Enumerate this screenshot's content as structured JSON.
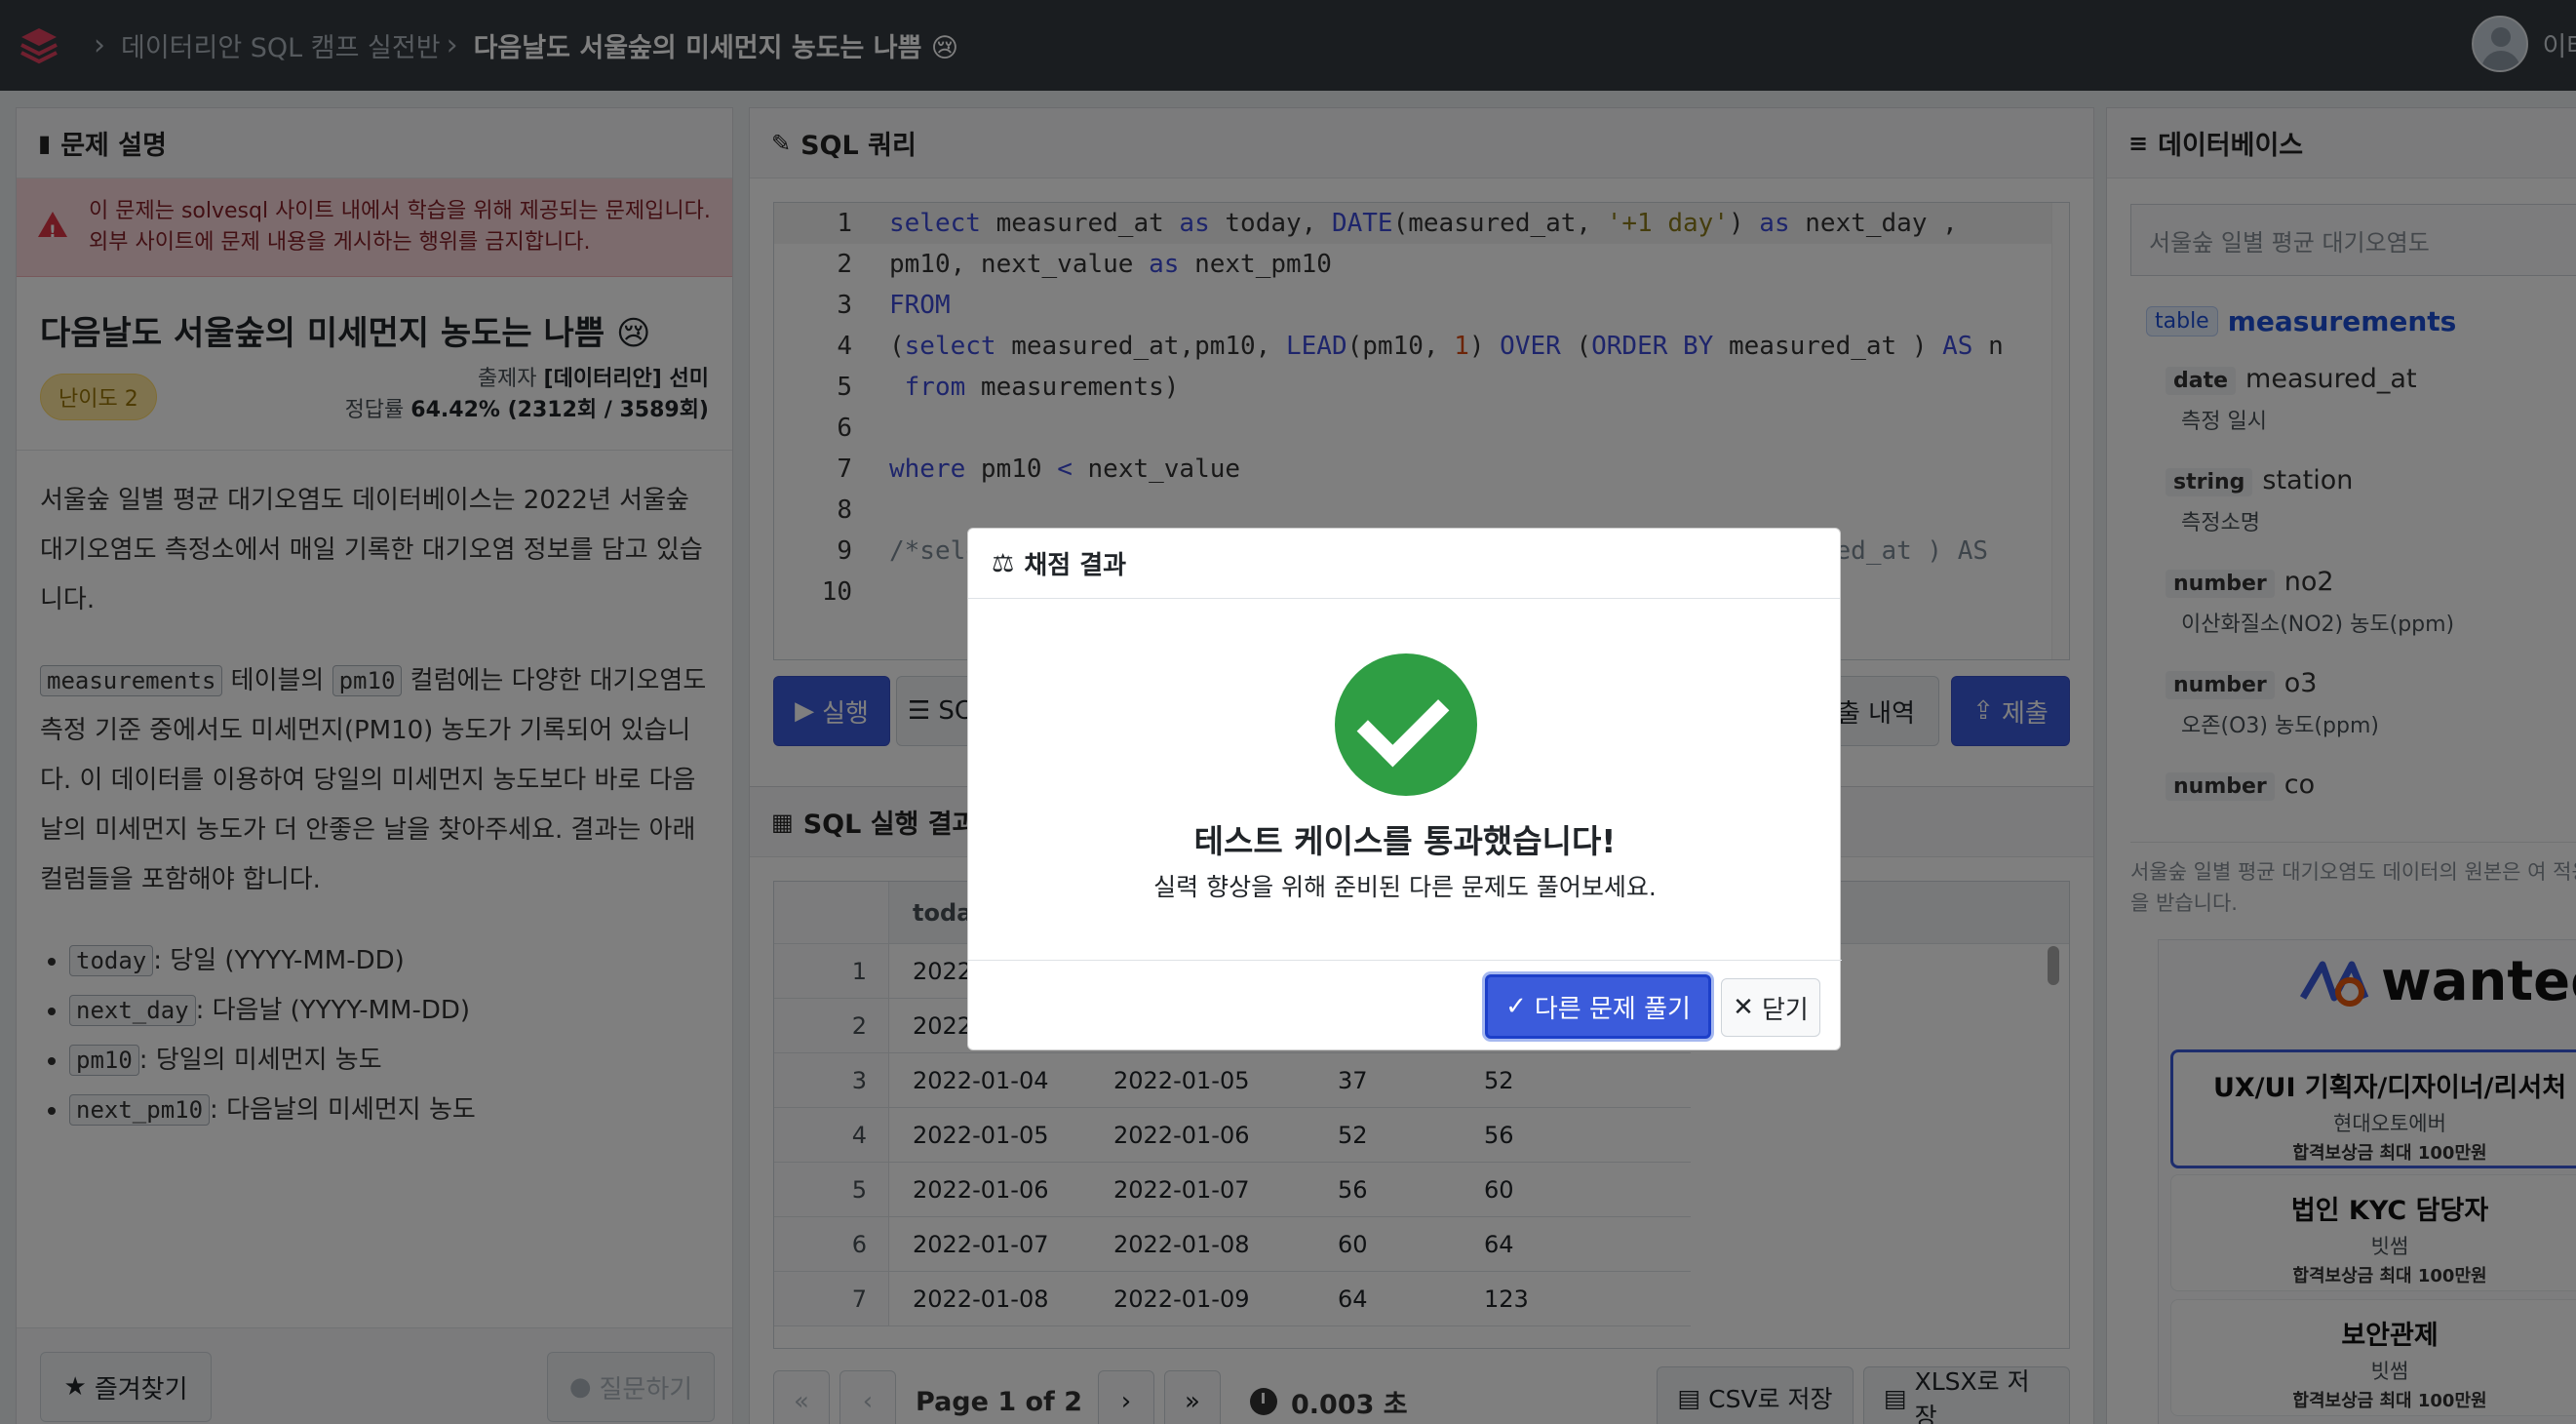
{
  "nav": {
    "breadcrumb_course": "데이터리안 SQL 캠프 실전반",
    "breadcrumb_problem": "다음날도 서울숲의 미세먼지 농도는 나쁨 😢",
    "user_name": "이태균"
  },
  "left": {
    "header": "문제 설명",
    "alert_line1": "이 문제는 solvesql 사이트 내에서 학습을 위해 제공되는 문제입니다.",
    "alert_line2": "외부 사이트에 문제 내용을 게시하는 행위를 금지합니다.",
    "title": "다음날도 서울숲의 미세먼지 농도는 나쁨 😢",
    "difficulty": "난이도 2",
    "author_label": "출제자",
    "author": "[데이터리안] 선미",
    "rate_label": "정답률",
    "rate": "64.42% (2312회 / 3589회)",
    "para1": "서울숲 일별 평균 대기오염도 데이터베이스는 2022년 서울숲 대기오염도 측정소에서 매일 기록한 대기오염 정보를 담고 있습니다.",
    "code_measurements": "measurements",
    "para2_a": " 테이블의 ",
    "code_pm10": "pm10",
    "para2_b": " 컬럼에는 다양한 대기오염도 측정 기준 중에서도 미세먼지(PM10) 농도가 기록되어 있습니다. 이 데이터를 이용하여 당일의 미세먼지 농도보다 바로 다음날의 미세먼지 농도가 더 안좋은 날을 찾아주세요. 결과는 아래 컬럼들을 포함해야 합니다.",
    "columns": [
      {
        "code": "today",
        "desc": ": 당일 (YYYY-MM-DD)"
      },
      {
        "code": "next_day",
        "desc": ": 다음날 (YYYY-MM-DD)"
      },
      {
        "code": "pm10",
        "desc": ": 당일의 미세먼지 농도"
      },
      {
        "code": "next_pm10",
        "desc": ": 다음날의 미세먼지 농도"
      }
    ],
    "fav_label": "즐겨찾기",
    "ask_label": "질문하기"
  },
  "sql": {
    "header": "SQL 쿼리",
    "run_label": "실행",
    "sc_label": "SC",
    "history_label": "출 내역",
    "submit_label": "제출"
  },
  "result": {
    "header": "SQL 실행 결과",
    "col_today": "today",
    "rows": [
      {
        "idx": "1",
        "today": "2022",
        "next": "",
        "pm10": "",
        "npm10": ""
      },
      {
        "idx": "2",
        "today": "2022",
        "next": "",
        "pm10": "",
        "npm10": ""
      },
      {
        "idx": "3",
        "today": "2022-01-04",
        "next": "2022-01-05",
        "pm10": "37",
        "npm10": "52"
      },
      {
        "idx": "4",
        "today": "2022-01-05",
        "next": "2022-01-06",
        "pm10": "52",
        "npm10": "56"
      },
      {
        "idx": "5",
        "today": "2022-01-06",
        "next": "2022-01-07",
        "pm10": "56",
        "npm10": "60"
      },
      {
        "idx": "6",
        "today": "2022-01-07",
        "next": "2022-01-08",
        "pm10": "60",
        "npm10": "64"
      },
      {
        "idx": "7",
        "today": "2022-01-08",
        "next": "2022-01-09",
        "pm10": "64",
        "npm10": "123"
      }
    ],
    "page_text": "Page 1 of 2",
    "time_text": "0.003 초",
    "csv_label": "CSV로 저장",
    "xlsx_label": "XLSX로 저장"
  },
  "db": {
    "header": "데이터베이스",
    "search_value": "서울숲 일별 평균 대기오염도",
    "table_badge": "table",
    "table_name": "measurements",
    "columns": [
      {
        "type": "date",
        "name": "measured_at",
        "desc": "측정 일시"
      },
      {
        "type": "string",
        "name": "station",
        "desc": "측정소명"
      },
      {
        "type": "number",
        "name": "no2",
        "desc": "이산화질소(NO2) 농도(ppm)"
      },
      {
        "type": "number",
        "name": "o3",
        "desc": "오존(O3) 농도(ppm)"
      },
      {
        "type": "number",
        "name": "co",
        "desc": ""
      }
    ],
    "note": "서울숲 일별 평균 대기오염도 데이터의 원본은 여 적용을 받습니다.",
    "ad_brand": "wanted",
    "jobs": [
      {
        "title": "UX/UI 기획자/디자이너/리서처",
        "company": "현대오토에버",
        "reward": "합격보상금 최대 100만원"
      },
      {
        "title": "법인 KYC 담당자",
        "company": "빗썸",
        "reward": "합격보상금 최대 100만원"
      },
      {
        "title": "보안관제",
        "company": "빗썸",
        "reward": "합격보상금 최대 100만원"
      }
    ]
  },
  "modal": {
    "header": "채점 결과",
    "title": "테스트 케이스를 통과했습니다!",
    "subtitle": "실력 향상을 위해 준비된 다른 문제도 풀어보세요.",
    "other_label": "다른 문제 풀기",
    "close_label": "닫기"
  },
  "colors": {
    "accent": "#3b5bdb",
    "success": "#2f9e44",
    "alert_bg": "#f8d7da",
    "topbar": "#343a40"
  }
}
